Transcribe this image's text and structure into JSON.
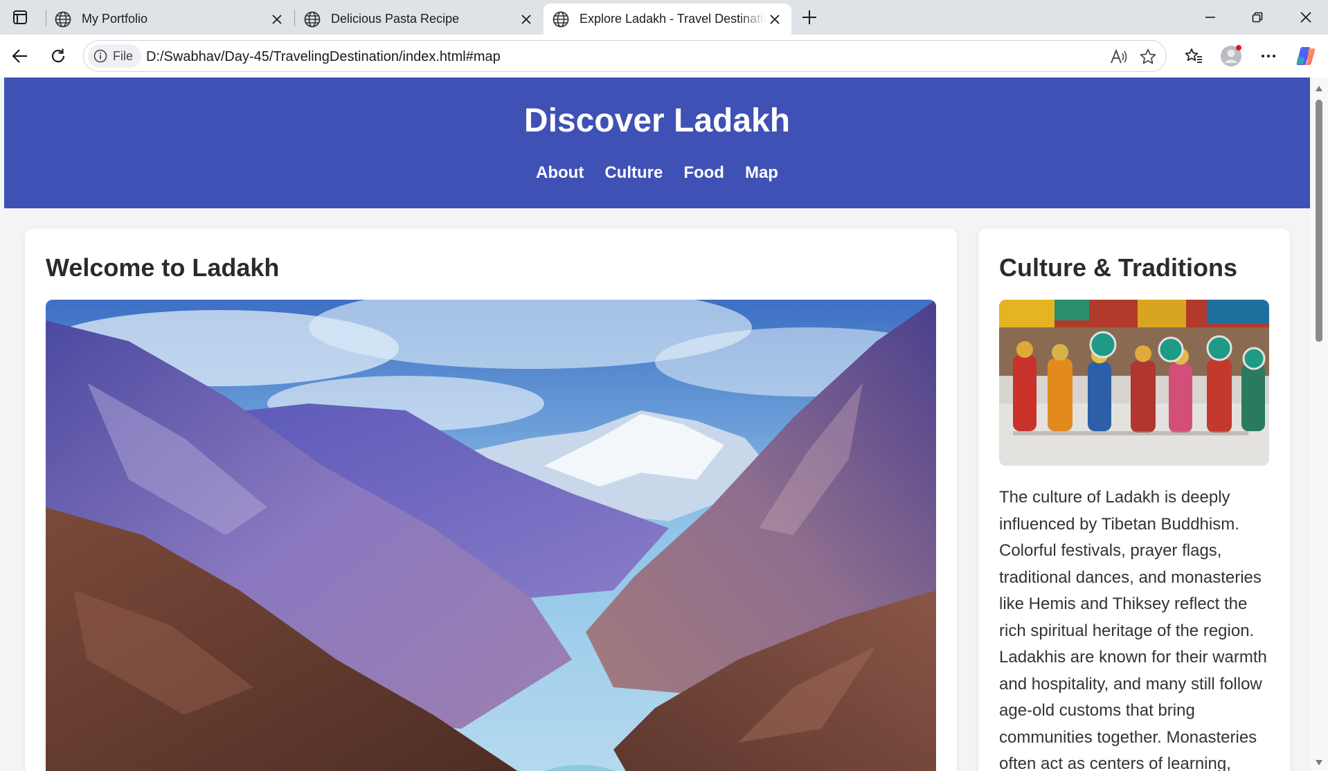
{
  "browser": {
    "tabs": [
      {
        "title": "My Portfolio",
        "active": false
      },
      {
        "title": "Delicious Pasta Recipe",
        "active": false
      },
      {
        "title": "Explore Ladakh - Travel Destination",
        "active": true
      }
    ],
    "site_info_label": "File",
    "url": "D:/Swabhav/Day-45/TravelingDestination/index.html#map"
  },
  "page": {
    "site_title": "Discover Ladakh",
    "nav": [
      "About",
      "Culture",
      "Food",
      "Map"
    ],
    "welcome": {
      "heading": "Welcome to Ladakh",
      "image_alt": "Ladakh mountain valley landscape"
    },
    "culture": {
      "heading": "Culture & Traditions",
      "image_alt": "Masked dancers at a monastery festival",
      "text": "The culture of Ladakh is deeply influenced by Tibetan Buddhism. Colorful festivals, prayer flags, traditional dances, and monasteries like Hemis and Thiksey reflect the rich spiritual heritage of the region. Ladakhis are known for their warmth and hospitality, and many still follow age-old customs that bring communities together. Monasteries often act as centers of learning,"
    }
  },
  "colors": {
    "header_bg": "#3f51b5",
    "page_bg": "#f4f4f4",
    "card_bg": "#ffffff"
  }
}
